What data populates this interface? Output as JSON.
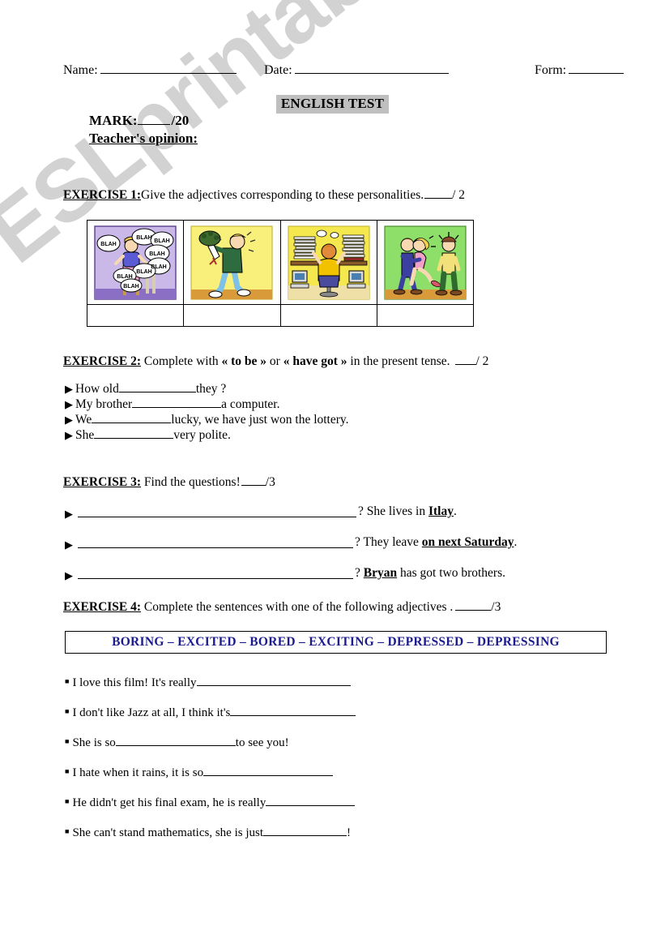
{
  "document": {
    "title": "ENGLISH TEST",
    "watermark": "ESLprintables.com",
    "accent_blue": "#1b1b8f",
    "title_background": "#bfbfbf"
  },
  "identity": {
    "name_label": "Name:",
    "date_label": "Date:",
    "form_label": "Form:"
  },
  "mark": {
    "label": "MARK:",
    "total": "/20",
    "teacher_opinion": "Teacher's opinion:"
  },
  "exercise1": {
    "number": "EXERCISE 1:",
    "description": "Give the adjectives corresponding to these  personalities.",
    "score": "/ 2",
    "pictures": [
      {
        "name": "talkative-woman-blah",
        "alt": "Cartoon woman talking with many BLAH speech bubbles",
        "background": "#c9b8e8",
        "bubble_text": "BLAH"
      },
      {
        "name": "man-with-flowers",
        "alt": "Cartoon man nervously holding a bouquet of flowers",
        "background": "#f8f07a"
      },
      {
        "name": "stressed-office-worker",
        "alt": "Cartoon person at desk overwhelmed by stacks of paper and computers",
        "background": "#f5e84f"
      },
      {
        "name": "jealous-man-couple",
        "alt": "Cartoon couple kissing while a jealous man looks on",
        "background": "#8ede6a"
      }
    ],
    "answer_cells": [
      "",
      "",
      "",
      ""
    ]
  },
  "exercise2": {
    "number": "EXERCISE 2:",
    "description_before": " Complete with ",
    "quoted1": "« to be »",
    "between": " or ",
    "quoted2": "« have got »",
    "description_after": " in the present tense.",
    "score": "/ 2",
    "bullet": "▶",
    "items": [
      {
        "before": "How old ",
        "blank_width": 95,
        "after": "they ?"
      },
      {
        "before": "My brother ",
        "blank_width": 110,
        "after": "a computer."
      },
      {
        "before": "We ",
        "blank_width": 98,
        "after": " lucky, we have just won the lottery."
      },
      {
        "before": "She ",
        "blank_width": 98,
        "after": "very polite."
      }
    ]
  },
  "exercise3": {
    "number": "EXERCISE 3:",
    "description": " Find the questions!",
    "score": "/3",
    "bullet": "▶",
    "items": [
      {
        "question_mark": "?",
        "answer_before": "  She lives in ",
        "answer_key": "Itlay",
        "answer_after": "."
      },
      {
        "question_mark": "?",
        "answer_before": " They leave ",
        "answer_key": "on next Saturday",
        "answer_after": "."
      },
      {
        "question_mark": "?",
        "answer_before": " ",
        "answer_key": "Bryan",
        "answer_after": " has got two brothers."
      }
    ]
  },
  "exercise4": {
    "number": "EXERCISE 4:",
    "description": " Complete the sentences  with one of the following adjectives .",
    "score": "/3",
    "adjectives_line": "BORING – EXCITED – BORED – EXCITING – DEPRESSED – DEPRESSING",
    "adjectives": [
      "BORING",
      "EXCITED",
      "BORED",
      "EXCITING",
      "DEPRESSED",
      "DEPRESSING"
    ],
    "bullet": "■",
    "items": [
      {
        "before": "I love this film! It's really",
        "blank_width": 190,
        "after": ""
      },
      {
        "before": "I don't like Jazz at all, I think it's ",
        "blank_width": 155,
        "after": ""
      },
      {
        "before": "She is so ",
        "blank_width": 148,
        "after": " to see you!"
      },
      {
        "before": "I hate when it rains, it is so ",
        "blank_width": 160,
        "after": ""
      },
      {
        "before": "He didn't get his final exam, he is really ",
        "blank_width": 110,
        "after": ""
      },
      {
        "before": "She can't stand  mathematics, she is just ",
        "blank_width": 103,
        "after": "!"
      }
    ]
  }
}
